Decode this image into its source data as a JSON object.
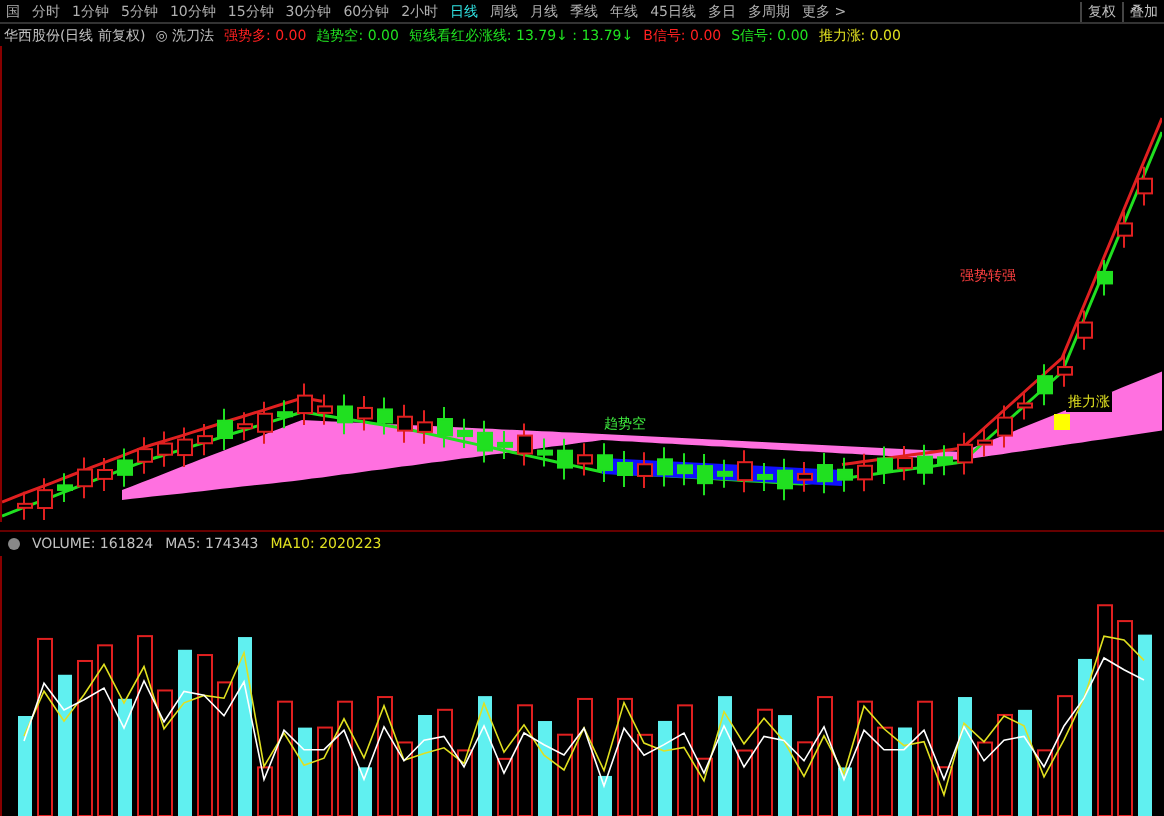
{
  "toolbar": {
    "tabs": [
      {
        "label": "国",
        "selected": false
      },
      {
        "label": "分时",
        "selected": false
      },
      {
        "label": "1分钟",
        "selected": false
      },
      {
        "label": "5分钟",
        "selected": false
      },
      {
        "label": "10分钟",
        "selected": false
      },
      {
        "label": "15分钟",
        "selected": false
      },
      {
        "label": "30分钟",
        "selected": false
      },
      {
        "label": "60分钟",
        "selected": false
      },
      {
        "label": "2小时",
        "selected": false
      },
      {
        "label": "日线",
        "selected": true
      },
      {
        "label": "周线",
        "selected": false
      },
      {
        "label": "月线",
        "selected": false
      },
      {
        "label": "季线",
        "selected": false
      },
      {
        "label": "年线",
        "selected": false
      },
      {
        "label": "45日线",
        "selected": false
      },
      {
        "label": "多日",
        "selected": false
      },
      {
        "label": "多周期",
        "selected": false
      },
      {
        "label": "更多 >",
        "selected": false
      }
    ],
    "right_buttons": [
      "复权",
      "叠加"
    ]
  },
  "indicator_line": {
    "title": "华西股份(日线 前复权)",
    "formula_marker": "◎",
    "formula": "洗刀法",
    "values": [
      {
        "label": "强势多:",
        "value": "0.00",
        "color": "#ff2020"
      },
      {
        "label": "趋势空:",
        "value": "0.00",
        "color": "#20e020"
      },
      {
        "label": "短线看红必涨线:",
        "value": "13.79↓ : 13.79↓",
        "color": "#20e020"
      },
      {
        "label": "B信号:",
        "value": "0.00",
        "color": "#ff2020"
      },
      {
        "label": "S信号:",
        "value": "0.00",
        "color": "#20e020"
      },
      {
        "label": "推力涨:",
        "value": "0.00",
        "color": "#e0e020"
      }
    ]
  },
  "chart_labels": [
    {
      "text": "趋势空",
      "kind": "green"
    },
    {
      "text": "推力涨",
      "kind": "yellow"
    },
    {
      "text": "强势转强",
      "kind": "red"
    }
  ],
  "volume_panel": {
    "values": [
      {
        "label": "VOLUME:",
        "value": "161824",
        "color": "#c0c0c0"
      },
      {
        "label": "MA5:",
        "value": "174343",
        "color": "#c0c0c0"
      },
      {
        "label": "MA10:",
        "value": "2020223",
        "color": "#e0e020"
      }
    ]
  }
}
